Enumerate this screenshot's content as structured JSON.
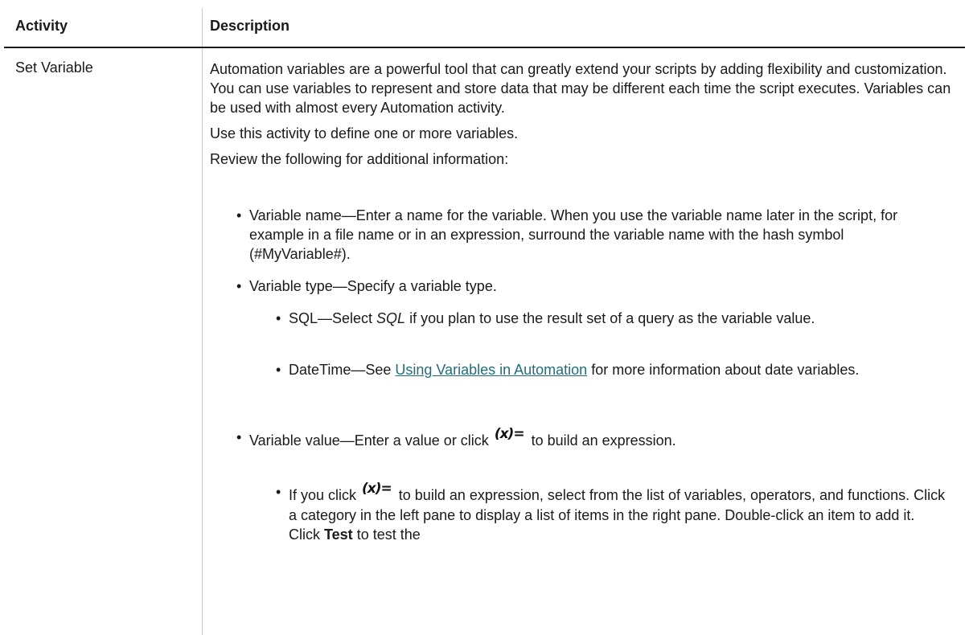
{
  "table": {
    "headers": {
      "activity": "Activity",
      "description": "Description"
    },
    "row": {
      "activity": "Set Variable",
      "para1": "Automation variables are a powerful tool that can greatly extend your scripts by adding flexibility and customization. You can use variables to represent and store data that may be different each time the script executes. Variables can be used with almost every Automation activity.",
      "para2": "Use this activity to define one or more variables.",
      "para3": "Review the following for additional information:",
      "bullet_name": "Variable name—Enter a name for the variable. When you use the variable name later in the script, for example in a file name or in an expression, surround the variable name with the hash symbol (#MyVariable#).",
      "bullet_type": "Variable type—Specify a variable type.",
      "sql_prefix": "SQL—Select ",
      "sql_em": "SQL",
      "sql_suffix": " if you plan to use the result set of a query as the variable value.",
      "dt_prefix": "DateTime—See ",
      "dt_link": "Using Variables in Automation",
      "dt_suffix": " for more information about date variables.",
      "value_prefix": "Variable value—Enter a value or click ",
      "value_suffix": " to build an expression.",
      "expr_icon_text": "(x)=",
      "click_prefix": "If you click ",
      "click_suffix": " to build an expression, select from the list of variables, operators, and functions. Click a category in the left pane to display a list of items in the right pane. Double-click an item to add it. Click ",
      "click_bold": "Test",
      "click_tail": " to test the"
    }
  },
  "colors": {
    "link": "#1f6e7e",
    "divider": "#c8c8c8",
    "rule": "#1a1a1a"
  }
}
